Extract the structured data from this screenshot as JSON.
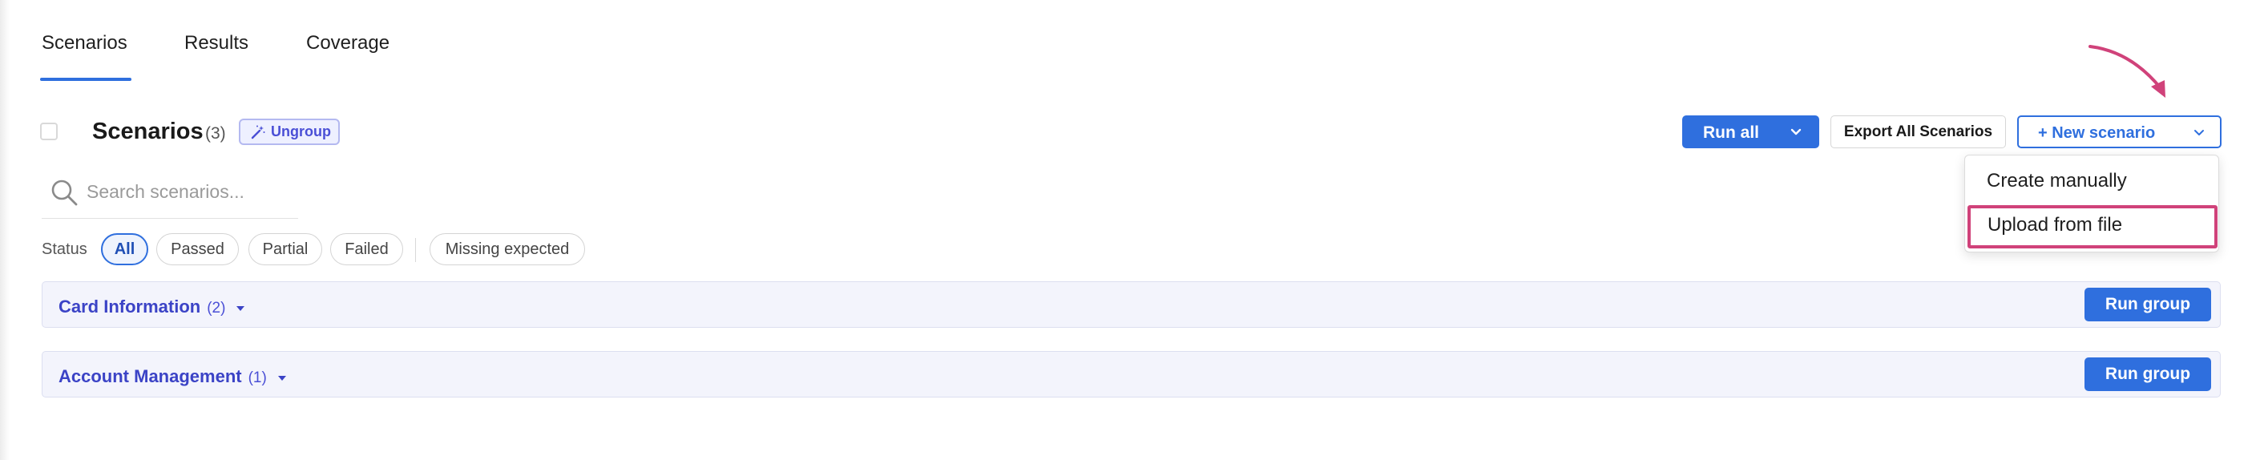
{
  "tabs": [
    {
      "label": "Scenarios",
      "active": true
    },
    {
      "label": "Results",
      "active": false
    },
    {
      "label": "Coverage",
      "active": false
    }
  ],
  "header": {
    "title": "Scenarios",
    "count": "(3)",
    "ungroup_label": "Ungroup",
    "run_all_label": "Run all",
    "export_label": "Export All Scenarios",
    "new_scenario_label": "+ New scenario"
  },
  "new_scenario_menu": {
    "items": [
      {
        "label": "Create manually",
        "highlighted": false
      },
      {
        "label": "Upload from file",
        "highlighted": true
      }
    ]
  },
  "search": {
    "placeholder": "Search scenarios...",
    "value": ""
  },
  "filters": {
    "label": "Status",
    "chips": [
      {
        "label": "All",
        "active": true
      },
      {
        "label": "Passed",
        "active": false
      },
      {
        "label": "Partial",
        "active": false
      },
      {
        "label": "Failed",
        "active": false
      },
      {
        "label": "Missing expected",
        "active": false
      }
    ]
  },
  "groups": [
    {
      "title": "Card Information",
      "count": "(2)",
      "action_label": "Run group"
    },
    {
      "title": "Account Management",
      "count": "(1)",
      "action_label": "Run group"
    }
  ],
  "colors": {
    "primary": "#2f6fde",
    "group_title": "#3b43c6",
    "annotation": "#d0427a"
  },
  "icons": {
    "ungroup": "magic-wand-icon",
    "dropdown": "chevron-down-icon",
    "search": "search-icon",
    "group_caret": "caret-down-icon",
    "annotation": "curved-arrow-icon"
  }
}
